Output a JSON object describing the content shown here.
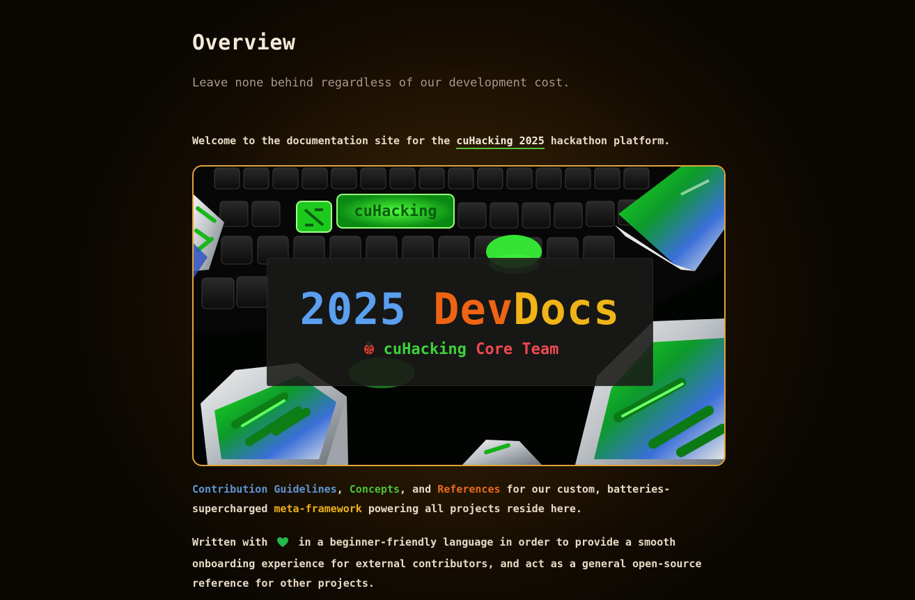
{
  "header": {
    "title": "Overview",
    "subtitle": "Leave none behind regardless of our development cost."
  },
  "intro": {
    "text_before": "Welcome to the documentation site for the ",
    "link_label": "cuHacking 2025",
    "text_after": " hackathon platform."
  },
  "hero": {
    "title_year": "2025",
    "title_dev": "Dev",
    "title_docs": "Docs",
    "subtitle_cu": "cuHacking",
    "subtitle_core": "Core Team",
    "keycap_label": "cuHacking",
    "bug_icon": "ladybug-icon"
  },
  "paragraph1": {
    "link_contribution": "Contribution Guidelines",
    "sep1": ", ",
    "link_concepts": "Concepts",
    "sep2": ", and ",
    "link_references": "References",
    "text_mid": " for our custom, batteries-supercharged ",
    "link_metaframework": "meta-framework",
    "text_end": " powering all projects reside here."
  },
  "paragraph2": {
    "text_before": "Written with",
    "heart_icon": "green-heart-icon",
    "text_after": "in a beginner-friendly language in order to provide a smooth onboarding experience for external contributors, and act as a general open-source reference for other projects."
  },
  "colors": {
    "accent_border": "#e0a43a",
    "link_blue": "#5f95d4",
    "link_green": "#4fc23a",
    "link_orange": "#e86a1c",
    "link_yellow": "#eeb11a",
    "underline_green": "#5bbf3a"
  }
}
